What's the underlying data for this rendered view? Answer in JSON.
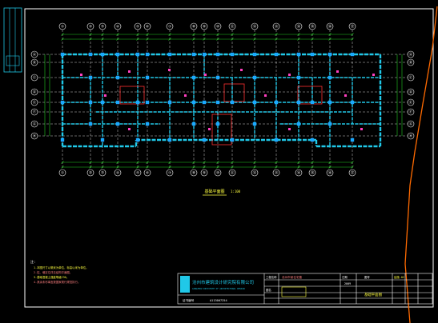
{
  "colors": {
    "background": "#000000",
    "frame": "#ffffff",
    "grid_axis": "#ffffff",
    "dimension": "#22cc22",
    "wall": "#20c8e8",
    "column": "#1aa8ff",
    "accent_red": "#ff3030",
    "magenta": "#ff40c0",
    "yellow": "#ffff40",
    "cut_line": "#ff6a00"
  },
  "plan": {
    "columns_top": [
      "①",
      "②",
      "③",
      "④",
      "⑤",
      "⑥",
      "⑦",
      "⑧",
      "⑨",
      "⑩",
      "⑪",
      "⑫",
      "⑬",
      "⑭",
      "⑮",
      "⑯",
      "⑰"
    ],
    "columns_bottom": [
      "①",
      "②",
      "③",
      "④",
      "⑤",
      "⑥",
      "⑦",
      "⑧",
      "⑨",
      "⑩",
      "⑪",
      "⑫",
      "⑬",
      "⑭",
      "⑮",
      "⑯",
      "⑰"
    ],
    "rows_left": [
      "Ⓐ",
      "Ⓑ",
      "Ⓒ",
      "Ⓓ",
      "Ⓔ",
      "Ⓕ",
      "Ⓖ",
      "Ⓗ"
    ],
    "rows_right": [
      "Ⓐ",
      "Ⓑ",
      "Ⓒ",
      "Ⓓ",
      "Ⓔ",
      "Ⓕ",
      "Ⓖ",
      "Ⓗ"
    ],
    "caption": "基础平面图",
    "scale": "1:100"
  },
  "notes": {
    "heading": "注:",
    "lines": [
      "1.本图尺寸以毫米为单位，标高以米为单位。",
      "2.柱、墙定位详见结构平面图。",
      "3.基础混凝土强度等级C30。",
      "4.其余未尽事宜按国家现行规范执行。"
    ]
  },
  "title_block": {
    "company_cn": "沧州市建筑设计研究院有限公司",
    "company_en": "CANGZHOU INSTITUTE OF ARCHITECTURAL DESIGN",
    "cert_label": "证书编号",
    "cert_no": "A113007254",
    "project_label": "工程名称",
    "project_name": "沧州市某住宅楼",
    "drawing_label": "图名",
    "drawing_name": "基础平面图",
    "sheet_label": "图号",
    "sheet_no": "结施-02",
    "date_label": "日期",
    "date": "2009"
  }
}
